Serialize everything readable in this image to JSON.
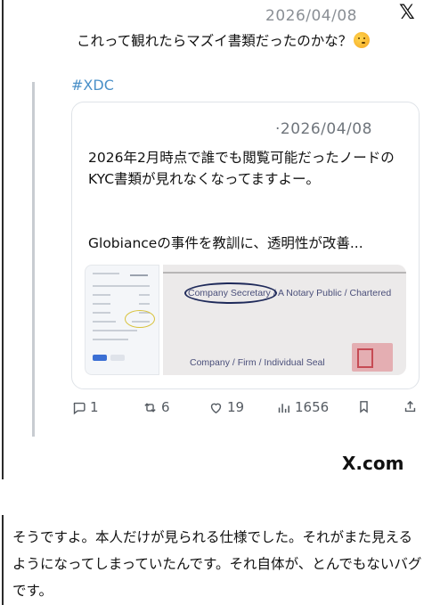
{
  "tweet": {
    "date": "2026/04/08",
    "text": "これって観れたらマズイ書類だったのかな？",
    "emoji": "thinking-face-icon"
  },
  "quote": {
    "hashtag": "#XDC",
    "date": "·2026/04/08",
    "text": "2026年2月時点で誰でも閲覧可能だったノードのKYC書類が見れなくなってますよー。",
    "text2": "Globianceの事件を教訓に、透明性が改善...",
    "image_text": {
      "company_secretary": "Company Secretary / A Notary Public / Chartered",
      "company_seal": "Company / Firm / Individual Seal"
    }
  },
  "actions": {
    "replies": "1",
    "retweets": "6",
    "likes": "19",
    "views": "1656"
  },
  "footer": {
    "xcom": "X.com"
  },
  "reply": {
    "text": "そうですよ。本人だけが見られる仕様でした。それがまた見えるようになってしまっていたんです。それ自体が、とんでもないバグです。"
  },
  "colors": {
    "hashtag": "#4a90c8",
    "muted": "#8a8f95",
    "card_border": "#dfe3e8"
  }
}
